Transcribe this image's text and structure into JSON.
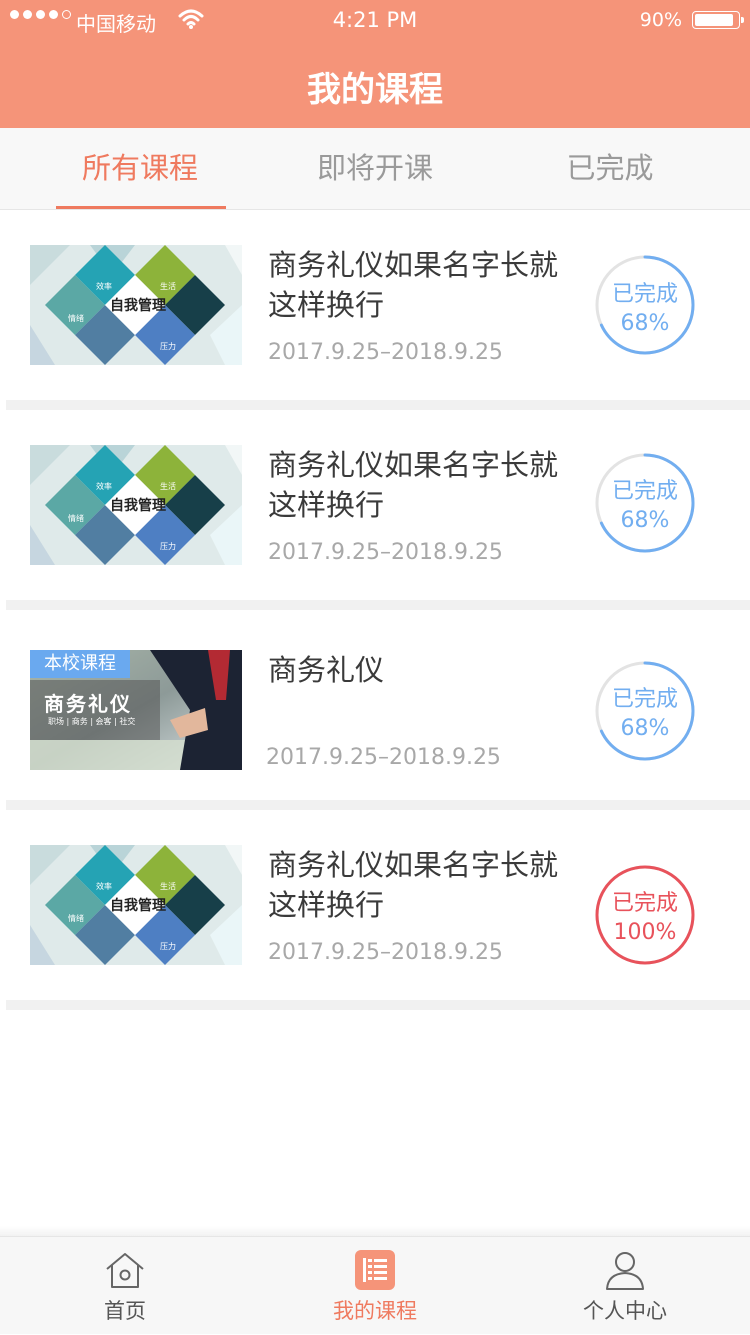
{
  "status_bar": {
    "carrier": "中国移动",
    "time": "4:21 PM",
    "battery": "90%"
  },
  "nav": {
    "title": "我的课程"
  },
  "tabs": [
    {
      "label": "所有课程",
      "active": true
    },
    {
      "label": "即将开课",
      "active": false
    },
    {
      "label": "已完成",
      "active": false
    }
  ],
  "courses": [
    {
      "title": "商务礼仪如果名字长就这样换行",
      "date": "2017.9.25–2018.9.25",
      "status_label": "已完成",
      "progress_text": "68%",
      "progress": 0.68,
      "thumb": {
        "center": "自我管理",
        "tags": [
          "效率",
          "生活",
          "情绪",
          "压力"
        ]
      }
    },
    {
      "title": "商务礼仪如果名字长就这样换行",
      "date": "2017.9.25–2018.9.25",
      "status_label": "已完成",
      "progress_text": "68%",
      "progress": 0.68,
      "thumb": {
        "center": "自我管理",
        "tags": [
          "效率",
          "生活",
          "情绪",
          "压力"
        ]
      }
    },
    {
      "title": "商务礼仪",
      "date": "2017.9.25–2018.9.25",
      "status_label": "已完成",
      "progress_text": "68%",
      "progress": 0.68,
      "thumb": {
        "badge": "本校课程",
        "heading": "商务礼仪",
        "sub": "职场 | 商务 | 会客 | 社交"
      }
    },
    {
      "title": "商务礼仪如果名字长就这样换行",
      "date": "2017.9.25–2018.9.25",
      "status_label": "已完成",
      "progress_text": "100%",
      "progress": 1.0,
      "thumb": {
        "center": "自我管理",
        "tags": [
          "效率",
          "生活",
          "情绪",
          "压力"
        ]
      }
    }
  ],
  "tabbar": [
    {
      "label": "首页",
      "icon": "home-icon",
      "active": false
    },
    {
      "label": "我的课程",
      "icon": "course-list-icon",
      "active": true
    },
    {
      "label": "个人中心",
      "icon": "user-icon",
      "active": false
    }
  ],
  "colors": {
    "brand": "#f59479",
    "active": "#ef7a5f",
    "progress_blue": "#72aef0",
    "progress_done": "#e8525b"
  }
}
